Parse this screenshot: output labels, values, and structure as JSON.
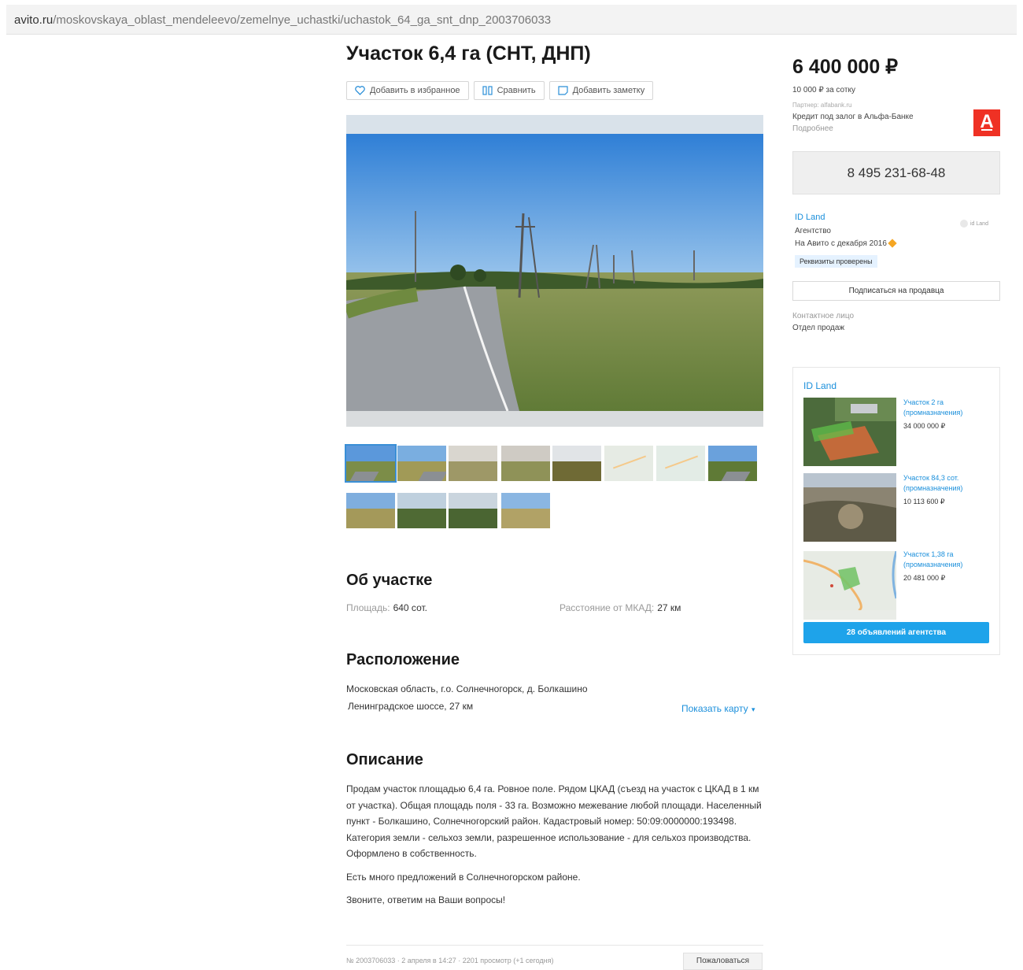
{
  "browser": {
    "url_domain": "avito.ru",
    "url_path": "/moskovskaya_oblast_mendeleevo/zemelnye_uchastki/uchastok_64_ga_snt_dnp_2003706033"
  },
  "listing": {
    "title": "Участок 6,4 га (СНТ, ДНП)",
    "actions": {
      "favorite": "Добавить в избранное",
      "compare": "Сравнить",
      "note": "Добавить заметку"
    }
  },
  "about": {
    "heading": "Об участке",
    "area_label": "Площадь:",
    "area_value": "640 сот.",
    "distance_label": "Расстояние от МКАД:",
    "distance_value": "27 км"
  },
  "location": {
    "heading": "Расположение",
    "address_line1": "Московская область, г.о. Солнечногорск, д. Болкашино",
    "address_line2": "Ленинградское шоссе, 27 км",
    "show_map": "Показать карту"
  },
  "description": {
    "heading": "Описание",
    "p1": "Продам участок площадью 6,4 га. Ровное поле. Рядом ЦКАД (съезд на участок с ЦКАД в 1 км от участка). Общая площадь поля - 33 га. Возможно межевание любой площади. Населенный пункт - Болкашино, Солнечногорский район. Кадастровый номер: 50:09:0000000:193498. Категория земли - сельхоз земли, разрешенное использование - для сельхоз производства. Оформлено в собственность.",
    "p2": "Есть много предложений в Солнечногорском районе.",
    "p3": "Звоните, ответим на Ваши вопросы!"
  },
  "footer": {
    "meta": "№ 2003706033 · 2 апреля в 14:27 · 2201 просмотр (+1 сегодня)",
    "complain": "Пожаловаться"
  },
  "sidebar": {
    "price": "6 400 000 ₽",
    "price_per_sotka": "10 000 ₽ за сотку",
    "partner_line": "Партнер: alfabank.ru",
    "credit_text": "Кредит под залог в Альфа-Банке",
    "more": "Подробнее",
    "bank_logo_letter": "А",
    "phone": "8 495 231-68-48",
    "seller_name": "ID Land",
    "seller_type": "Агентство",
    "seller_since": "На Авито с декабря 2016",
    "seller_logo_text": "id Land",
    "verified": "Реквизиты проверены",
    "subscribe": "Подписаться на продавца",
    "contact_label": "Контактное лицо",
    "contact_value": "Отдел продаж"
  },
  "agency": {
    "title": "ID Land",
    "lots": [
      {
        "title": "Участок 2 га (промназначения)",
        "price": "34 000 000 ₽"
      },
      {
        "title": "Участок 84,3 сот. (промназначения)",
        "price": "10 113 600 ₽"
      },
      {
        "title": "Участок 1,38 га (промназначения)",
        "price": "20 481 000 ₽"
      }
    ],
    "all_button": "28 объявлений агентства"
  },
  "colors": {
    "link": "#1a8fdb",
    "agency_button": "#1ea3ea",
    "bank_red": "#ef3124",
    "active_thumb": "#3a8fd6"
  }
}
